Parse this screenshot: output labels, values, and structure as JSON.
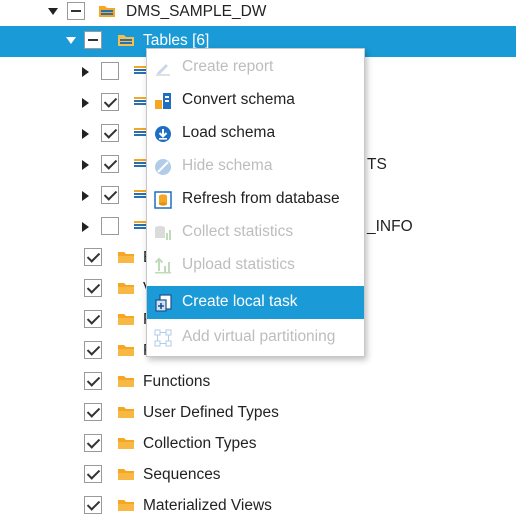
{
  "tree": {
    "root": {
      "label": "DMS_SAMPLE_DW"
    },
    "tables_node": {
      "label": "Tables [6]"
    },
    "table_rows": [
      {
        "label": "",
        "checked": false
      },
      {
        "label": "",
        "checked": true
      },
      {
        "label": "",
        "checked": true
      },
      {
        "label": "TS",
        "checked": true
      },
      {
        "label": "",
        "checked": true
      },
      {
        "label": "_INFO",
        "checked": false
      }
    ],
    "category_rows": [
      {
        "label": "E"
      },
      {
        "label": "V"
      },
      {
        "label": "P"
      },
      {
        "label": "P"
      },
      {
        "label": "Functions"
      },
      {
        "label": "User Defined Types"
      },
      {
        "label": "Collection Types"
      },
      {
        "label": "Sequences"
      },
      {
        "label": "Materialized Views"
      }
    ]
  },
  "context_menu": {
    "items": [
      {
        "label": "Create report",
        "icon": "report-icon",
        "enabled": false
      },
      {
        "label": "Convert schema",
        "icon": "convert-schema-icon",
        "enabled": true
      },
      {
        "label": "Load schema",
        "icon": "load-schema-icon",
        "enabled": true
      },
      {
        "label": "Hide schema",
        "icon": "hide-schema-icon",
        "enabled": false
      },
      {
        "label": "Refresh from database",
        "icon": "refresh-database-icon",
        "enabled": true
      },
      {
        "label": "Collect statistics",
        "icon": "collect-statistics-icon",
        "enabled": false
      },
      {
        "label": "Upload statistics",
        "icon": "upload-statistics-icon",
        "enabled": false
      },
      {
        "label": "Create local task",
        "icon": "create-task-icon",
        "enabled": true,
        "highlighted": true
      },
      {
        "label": "Add virtual partitioning",
        "icon": "partitioning-icon",
        "enabled": false
      }
    ]
  },
  "colors": {
    "selection": "#1a9bd7",
    "folder": "#f5a623",
    "disabled_text": "#bdbdbd"
  }
}
